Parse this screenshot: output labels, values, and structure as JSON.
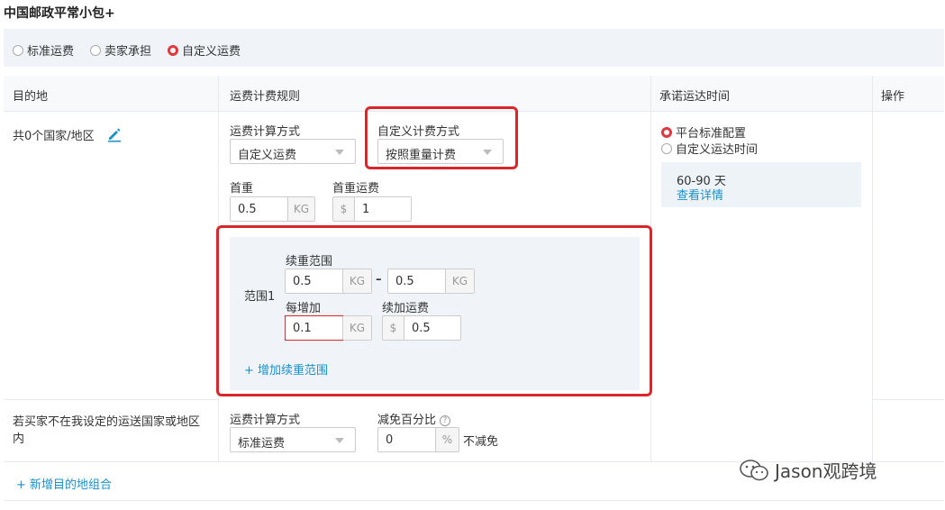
{
  "title": "中国邮政平常小包+",
  "shipping_options": [
    {
      "label": "标准运费",
      "selected": false
    },
    {
      "label": "卖家承担",
      "selected": false
    },
    {
      "label": "自定义运费",
      "selected": true
    }
  ],
  "columns": {
    "destination": "目的地",
    "rules": "运费计费规则",
    "delivery_time": "承诺运达时间",
    "actions": "操作"
  },
  "row1": {
    "destination_count": "共0个国家/地区",
    "calc_method_label": "运费计算方式",
    "calc_method_value": "自定义运费",
    "custom_method_label": "自定义计费方式",
    "custom_method_value": "按照重量计费",
    "first_weight_label": "首重",
    "first_weight_value": "0.5",
    "first_weight_unit": "KG",
    "first_fee_label": "首重运费",
    "first_fee_currency": "$",
    "first_fee_value": "1",
    "range": {
      "name": "范围1",
      "continued_range_label": "续重范围",
      "from_value": "0.5",
      "from_unit": "KG",
      "dash": "–",
      "to_value": "0.5",
      "to_unit": "KG",
      "increment_label": "每增加",
      "increment_value": "0.1",
      "increment_unit": "KG",
      "add_fee_label": "续加运费",
      "add_fee_currency": "$",
      "add_fee_value": "0.5"
    },
    "add_range_link": "+ 增加续重范围",
    "delivery_options": [
      {
        "label": "平台标准配置",
        "selected": true
      },
      {
        "label": "自定义运达时间",
        "selected": false
      }
    ],
    "delivery_days": "60-90 天",
    "view_details": "查看详情"
  },
  "row2": {
    "destination_line1": "若买家不在我设定的运送国家或地区",
    "destination_line2": "内",
    "calc_method_label": "运费计算方式",
    "calc_method_value": "标准运费",
    "discount_label": "减免百分比",
    "discount_value": "0",
    "discount_unit": "%",
    "no_discount": "不减免"
  },
  "add_destination_link": "+ 新增目的地组合",
  "watermark": "Jason观跨境",
  "colors": {
    "accent_red": "#d9252c",
    "link_blue": "#1a90c8",
    "panel_bg": "#f0f4f8"
  }
}
